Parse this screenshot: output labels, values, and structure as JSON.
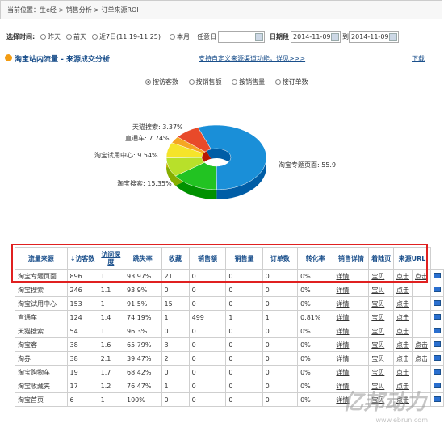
{
  "breadcrumb": "当前位置：生e经 > 销售分析 > 订单来源ROI",
  "filter": {
    "label": "选择时间:",
    "options": [
      "昨天",
      "前天",
      "近7日(11.19-11.25)",
      "本月",
      "任意日"
    ],
    "date_label": "日期段",
    "date_from": "2014-11-09",
    "to_label": "到",
    "date_to": "2014-11-09"
  },
  "section": {
    "title": "淘宝站内流量 - 来源成交分析",
    "link": "支持自定义来源渠道功能，详见>>>",
    "download": "下载"
  },
  "metric_options": [
    "按访客数",
    "按销售额",
    "按销售量",
    "按订单数"
  ],
  "colors": {
    "accent": "#1a4f8b",
    "highlight": "#e02020",
    "pie": [
      "#1a8fd8",
      "#38c8e0",
      "#22c322",
      "#b8e02a",
      "#f5e42a",
      "#f5a623",
      "#e84a2a"
    ]
  },
  "chart_data": {
    "type": "pie",
    "style": "3d-donut",
    "slices": [
      {
        "label": "淘宝专题页面",
        "value": 55.9,
        "display": "淘宝专题页面: 55.9"
      },
      {
        "label": "淘宝搜索",
        "value": 15.35,
        "display": "淘宝搜索: 15.35%"
      },
      {
        "label": "淘宝试用中心",
        "value": 9.54,
        "display": "淘宝试用中心: 9.54%"
      },
      {
        "label": "直通车",
        "value": 7.74,
        "display": "直通车: 7.74%"
      },
      {
        "label": "天猫搜索",
        "value": 3.37,
        "display": "天猫搜索: 3.37%"
      }
    ]
  },
  "table": {
    "headers": [
      "流量来源",
      "↓访客数",
      "访问深度",
      "跳失率",
      "收藏",
      "销售额",
      "销售量",
      "订单数",
      "转化率",
      "销售详情",
      "着陆页",
      "来源URL"
    ],
    "rows": [
      [
        "淘宝专题页面",
        "896",
        "1",
        "93.97%",
        "21",
        "0",
        "0",
        "0",
        "0%",
        "详情",
        "宝贝",
        "点击",
        "点击"
      ],
      [
        "淘宝搜索",
        "246",
        "1.1",
        "93.9%",
        "0",
        "0",
        "0",
        "0",
        "0%",
        "详情",
        "宝贝",
        "点击",
        ""
      ],
      [
        "淘宝试用中心",
        "153",
        "1",
        "91.5%",
        "15",
        "0",
        "0",
        "0",
        "0%",
        "详情",
        "宝贝",
        "点击",
        ""
      ],
      [
        "直通车",
        "124",
        "1.4",
        "74.19%",
        "1",
        "499",
        "1",
        "1",
        "0.81%",
        "详情",
        "宝贝",
        "点击",
        ""
      ],
      [
        "天猫搜索",
        "54",
        "1",
        "96.3%",
        "0",
        "0",
        "0",
        "0",
        "0%",
        "详情",
        "宝贝",
        "点击",
        ""
      ],
      [
        "淘宝客",
        "38",
        "1.6",
        "65.79%",
        "3",
        "0",
        "0",
        "0",
        "0%",
        "详情",
        "宝贝",
        "点击",
        "点击"
      ],
      [
        "淘券",
        "38",
        "2.1",
        "39.47%",
        "2",
        "0",
        "0",
        "0",
        "0%",
        "详情",
        "宝贝",
        "点击",
        "点击"
      ],
      [
        "淘宝购物车",
        "19",
        "1.7",
        "68.42%",
        "0",
        "0",
        "0",
        "0",
        "0%",
        "详情",
        "宝贝",
        "点击",
        ""
      ],
      [
        "淘宝收藏夹",
        "17",
        "1.2",
        "76.47%",
        "1",
        "0",
        "0",
        "0",
        "0%",
        "详情",
        "宝贝",
        "点击",
        ""
      ],
      [
        "淘宝首页",
        "6",
        "1",
        "100%",
        "0",
        "0",
        "0",
        "0",
        "0%",
        "详情",
        "宝贝",
        "点击",
        ""
      ]
    ]
  },
  "watermark": "亿邦动力",
  "watermark_url": "www.ebrun.com"
}
